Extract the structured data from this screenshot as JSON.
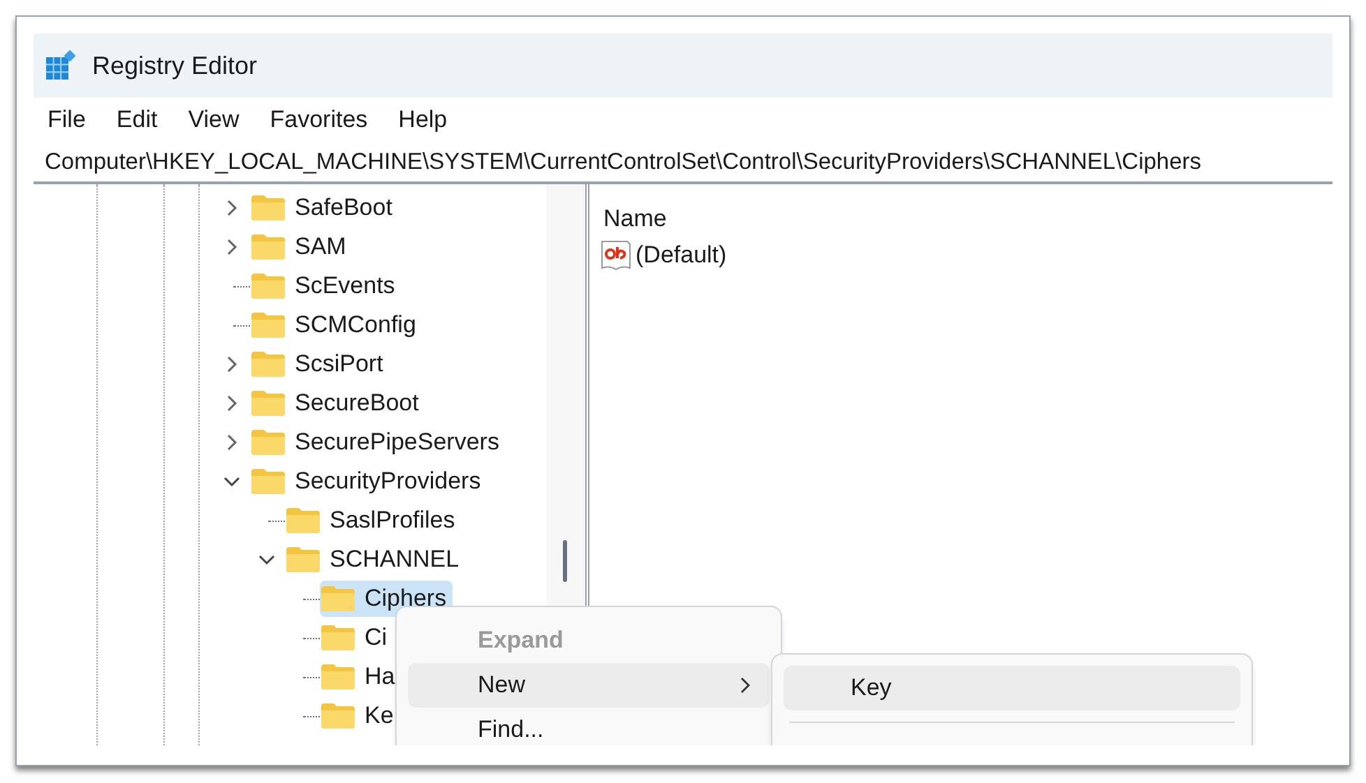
{
  "window": {
    "title": "Registry Editor"
  },
  "menu_bar": [
    "File",
    "Edit",
    "View",
    "Favorites",
    "Help"
  ],
  "address_bar": "Computer\\HKEY_LOCAL_MACHINE\\SYSTEM\\CurrentControlSet\\Control\\SecurityProviders\\SCHANNEL\\Ciphers",
  "tree": [
    {
      "label": "SafeBoot",
      "kind": "collapsed",
      "selected": false
    },
    {
      "label": "SAM",
      "kind": "collapsed",
      "selected": false
    },
    {
      "label": "ScEvents",
      "kind": "leaf",
      "selected": false
    },
    {
      "label": "SCMConfig",
      "kind": "leaf",
      "selected": false
    },
    {
      "label": "ScsiPort",
      "kind": "collapsed",
      "selected": false
    },
    {
      "label": "SecureBoot",
      "kind": "collapsed",
      "selected": false
    },
    {
      "label": "SecurePipeServers",
      "kind": "collapsed",
      "selected": false
    },
    {
      "label": "SecurityProviders",
      "kind": "expanded",
      "selected": false,
      "children": [
        {
          "label": "SaslProfiles",
          "kind": "leaf",
          "selected": false
        },
        {
          "label": "SCHANNEL",
          "kind": "expanded",
          "selected": false,
          "children": [
            {
              "label": "Ciphers",
              "kind": "leaf",
              "selected": true
            },
            {
              "label": "Ci",
              "kind": "leaf",
              "selected": false
            },
            {
              "label": "Ha",
              "kind": "leaf",
              "selected": false
            },
            {
              "label": "Ke",
              "kind": "leaf",
              "selected": false
            }
          ]
        }
      ]
    }
  ],
  "values": {
    "columns": [
      "Name"
    ],
    "rows": [
      {
        "name": "(Default)"
      }
    ]
  },
  "context_menu": [
    {
      "label": "Expand",
      "disabled": true,
      "selected": false,
      "submenu": false
    },
    {
      "label": "New",
      "disabled": false,
      "selected": true,
      "submenu": true
    },
    {
      "label": "Find...",
      "disabled": false,
      "selected": false,
      "submenu": false
    }
  ],
  "submenu": [
    {
      "label": "Key",
      "selected": true
    }
  ]
}
